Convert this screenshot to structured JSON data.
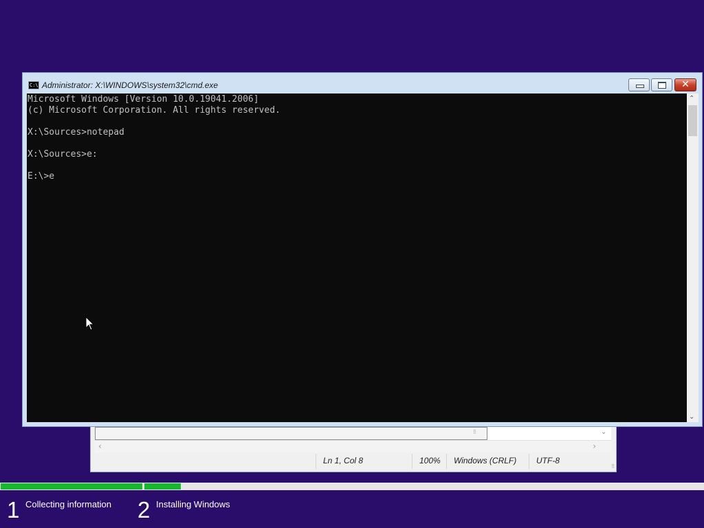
{
  "cmd": {
    "title": "Administrator: X:\\WINDOWS\\system32\\cmd.exe",
    "icon_text": "C:\\",
    "lines": [
      "Microsoft Windows [Version 10.0.19041.2006]",
      "(c) Microsoft Corporation. All rights reserved.",
      "",
      "X:\\Sources>notepad",
      "",
      "X:\\Sources>e:",
      "",
      "E:\\>e"
    ],
    "buttons": {
      "minimize_icon": "minimize-icon",
      "maximize_icon": "maximize-icon",
      "close_symbol": "✕"
    }
  },
  "notepad": {
    "status": {
      "position": "Ln 1, Col 8",
      "zoom": "100%",
      "line_ending": "Windows (CRLF)",
      "encoding": "UTF-8"
    }
  },
  "setup": {
    "steps": [
      {
        "number": "1",
        "label": "Collecting information"
      },
      {
        "number": "2",
        "label": "Installing Windows"
      }
    ],
    "progress": {
      "step1_fraction": 1.0,
      "step2_fraction": 0.065
    },
    "colors": {
      "background": "#2a0c6b",
      "progress": "#17b82d",
      "track": "#e6e6e6"
    }
  }
}
